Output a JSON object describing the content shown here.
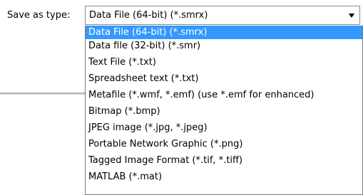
{
  "save_as_type": {
    "label": "Save as type:",
    "selected_value": "Data File (64-bit) (*.smrx)",
    "options": [
      {
        "label": "Data File (64-bit) (*.smrx)",
        "selected": true
      },
      {
        "label": "Data file (32-bit) (*.smr)"
      },
      {
        "label": "Text File (*.txt)"
      },
      {
        "label": "Spreadsheet text (*.txt)"
      },
      {
        "label": "Metafile (*.wmf, *.emf) (use *.emf for enhanced)"
      },
      {
        "label": "Bitmap (*.bmp)"
      },
      {
        "label": "JPEG image (*.jpg, *.jpeg)"
      },
      {
        "label": "Portable Network Graphic (*.png)"
      },
      {
        "label": "Tagged Image Format (*.tif, *.tiff)"
      },
      {
        "label": "MATLAB (*.mat)"
      }
    ]
  },
  "colors": {
    "highlight": "#3399ff"
  },
  "icons": {
    "dropdown": "chevron-down-icon"
  }
}
